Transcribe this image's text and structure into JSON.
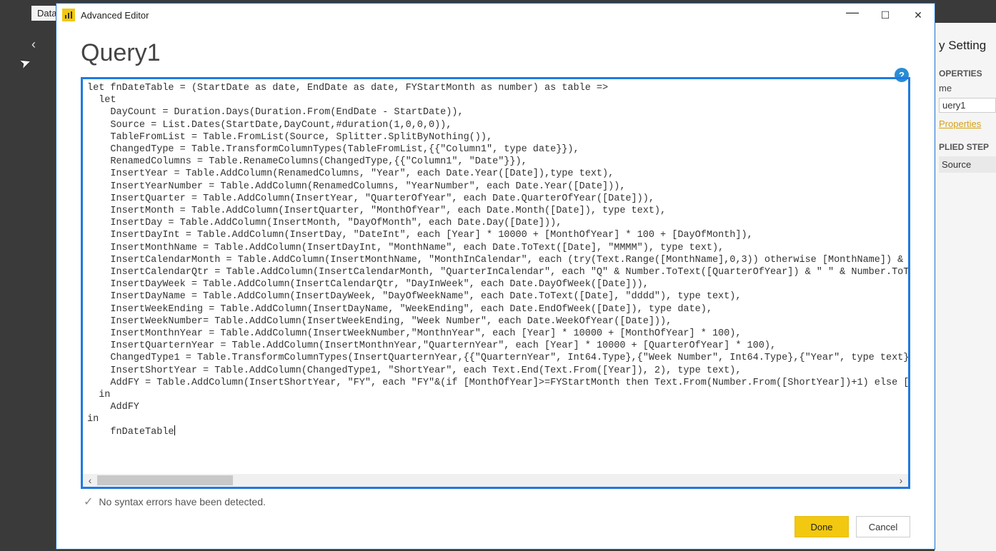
{
  "background": {
    "tab_label": "Data",
    "right_panel": {
      "header": "y Setting",
      "section_properties": "OPERTIES",
      "name_label": "me",
      "name_value": "uery1",
      "all_properties_link": "Properties",
      "section_steps": "PLIED STEP",
      "step_source": "Source"
    }
  },
  "window": {
    "title": "Advanced Editor",
    "query_name": "Query1",
    "status_message": "No syntax errors have been detected.",
    "buttons": {
      "done": "Done",
      "cancel": "Cancel"
    },
    "code_lines": [
      "let fnDateTable = (StartDate as date, EndDate as date, FYStartMonth as number) as table =>",
      "  let",
      "    DayCount = Duration.Days(Duration.From(EndDate - StartDate)),",
      "    Source = List.Dates(StartDate,DayCount,#duration(1,0,0,0)),",
      "    TableFromList = Table.FromList(Source, Splitter.SplitByNothing()),",
      "    ChangedType = Table.TransformColumnTypes(TableFromList,{{\"Column1\", type date}}),",
      "    RenamedColumns = Table.RenameColumns(ChangedType,{{\"Column1\", \"Date\"}}),",
      "    InsertYear = Table.AddColumn(RenamedColumns, \"Year\", each Date.Year([Date]),type text),",
      "    InsertYearNumber = Table.AddColumn(RenamedColumns, \"YearNumber\", each Date.Year([Date])),",
      "    InsertQuarter = Table.AddColumn(InsertYear, \"QuarterOfYear\", each Date.QuarterOfYear([Date])),",
      "    InsertMonth = Table.AddColumn(InsertQuarter, \"MonthOfYear\", each Date.Month([Date]), type text),",
      "    InsertDay = Table.AddColumn(InsertMonth, \"DayOfMonth\", each Date.Day([Date])),",
      "    InsertDayInt = Table.AddColumn(InsertDay, \"DateInt\", each [Year] * 10000 + [MonthOfYear] * 100 + [DayOfMonth]),",
      "    InsertMonthName = Table.AddColumn(InsertDayInt, \"MonthName\", each Date.ToText([Date], \"MMMM\"), type text),",
      "    InsertCalendarMonth = Table.AddColumn(InsertMonthName, \"MonthInCalendar\", each (try(Text.Range([MonthName],0,3)) otherwise [MonthName]) & \"",
      "    InsertCalendarQtr = Table.AddColumn(InsertCalendarMonth, \"QuarterInCalendar\", each \"Q\" & Number.ToText([QuarterOfYear]) & \" \" & Number.ToTe",
      "    InsertDayWeek = Table.AddColumn(InsertCalendarQtr, \"DayInWeek\", each Date.DayOfWeek([Date])),",
      "    InsertDayName = Table.AddColumn(InsertDayWeek, \"DayOfWeekName\", each Date.ToText([Date], \"dddd\"), type text),",
      "    InsertWeekEnding = Table.AddColumn(InsertDayName, \"WeekEnding\", each Date.EndOfWeek([Date]), type date),",
      "    InsertWeekNumber= Table.AddColumn(InsertWeekEnding, \"Week Number\", each Date.WeekOfYear([Date])),",
      "    InsertMonthnYear = Table.AddColumn(InsertWeekNumber,\"MonthnYear\", each [Year] * 10000 + [MonthOfYear] * 100),",
      "    InsertQuarternYear = Table.AddColumn(InsertMonthnYear,\"QuarternYear\", each [Year] * 10000 + [QuarterOfYear] * 100),",
      "    ChangedType1 = Table.TransformColumnTypes(InsertQuarternYear,{{\"QuarternYear\", Int64.Type},{\"Week Number\", Int64.Type},{\"Year\", type text},",
      "    InsertShortYear = Table.AddColumn(ChangedType1, \"ShortYear\", each Text.End(Text.From([Year]), 2), type text),",
      "    AddFY = Table.AddColumn(InsertShortYear, \"FY\", each \"FY\"&(if [MonthOfYear]>=FYStartMonth then Text.From(Number.From([ShortYear])+1) else [S",
      "  in",
      "    AddFY",
      "in",
      "    fnDateTable"
    ]
  }
}
